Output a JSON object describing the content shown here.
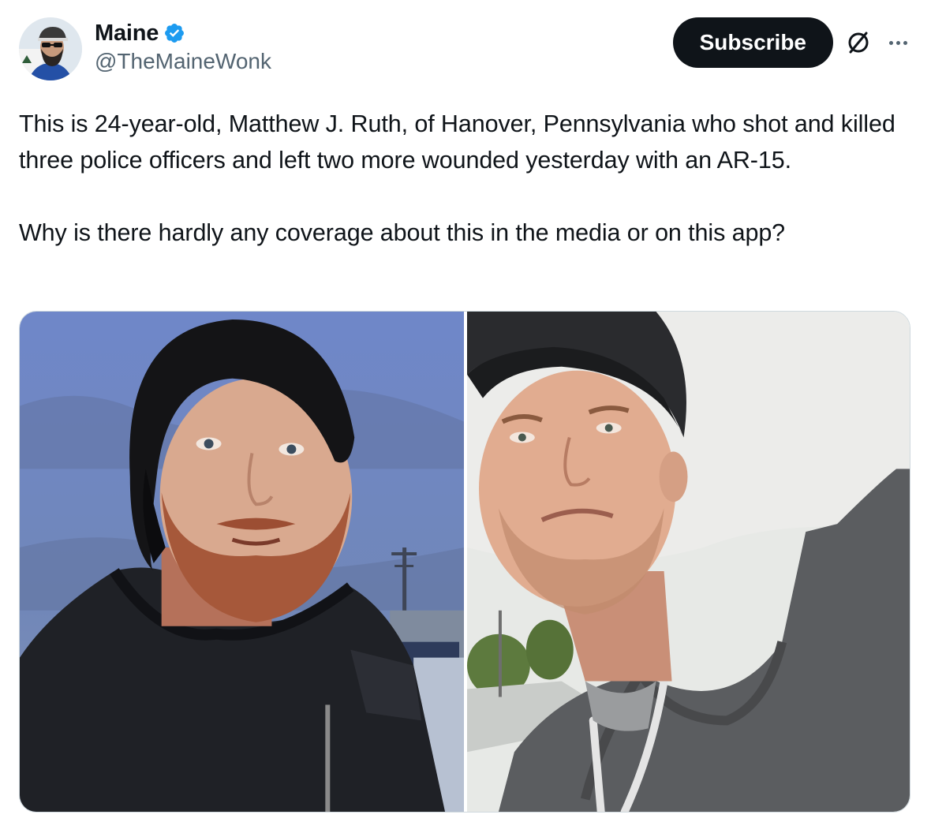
{
  "author": {
    "display_name": "Maine",
    "handle": "@TheMaineWonk",
    "verified": true,
    "avatar_icon": "profile-photo",
    "verified_icon": "verified-badge-icon"
  },
  "actions": {
    "subscribe_label": "Subscribe",
    "grok_icon": "grok-icon",
    "more_icon": "more-icon"
  },
  "tweet": {
    "text": "This is 24-year-old, Matthew J. Ruth, of Hanover, Pennsylvania who shot and killed three police officers and left two more wounded yesterday with an AR-15.\n\nWhy is there hardly any coverage about this in the media or on this app?"
  },
  "media": {
    "count": 2
  },
  "colors": {
    "verified_blue": "#1d9bf0",
    "subscribe_bg": "#0f1419",
    "secondary_text": "#536471",
    "border": "#cfd9de"
  }
}
